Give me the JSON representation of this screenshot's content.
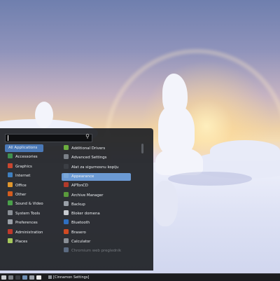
{
  "menu": {
    "search": {
      "value": "",
      "placeholder": ""
    },
    "categories": [
      {
        "label": "All Applications",
        "selected": true,
        "color": "#4a78b6"
      },
      {
        "label": "Accessories",
        "selected": false,
        "color": "#3f8f4f"
      },
      {
        "label": "Graphics",
        "selected": false,
        "color": "#c9462f"
      },
      {
        "label": "Internet",
        "selected": false,
        "color": "#3e7fbf"
      },
      {
        "label": "Office",
        "selected": false,
        "color": "#e0962c"
      },
      {
        "label": "Other",
        "selected": false,
        "color": "#d35c1e"
      },
      {
        "label": "Sound & Video",
        "selected": false,
        "color": "#4aa04a"
      },
      {
        "label": "System Tools",
        "selected": false,
        "color": "#8a8f96"
      },
      {
        "label": "Preferences",
        "selected": false,
        "color": "#9aa0a8"
      },
      {
        "label": "Administration",
        "selected": false,
        "color": "#c0392b"
      },
      {
        "label": "Places",
        "selected": false,
        "color": "#a5c85b"
      }
    ],
    "apps": [
      {
        "label": "Additional Drivers",
        "selected": false,
        "dim": false,
        "color": "#6cae3f"
      },
      {
        "label": "Advanced Settings",
        "selected": false,
        "dim": false,
        "color": "#7a7f86"
      },
      {
        "label": "Alat za sigurnosnu kopiju",
        "selected": false,
        "dim": false,
        "color": "#3b3e44"
      },
      {
        "label": "Appearance",
        "selected": true,
        "dim": false,
        "color": "#7aa7d9"
      },
      {
        "label": "APTonCD",
        "selected": false,
        "dim": false,
        "color": "#b23a2a"
      },
      {
        "label": "Archive Manager",
        "selected": false,
        "dim": false,
        "color": "#5a9a3c"
      },
      {
        "label": "Backup",
        "selected": false,
        "dim": false,
        "color": "#9aa0a8"
      },
      {
        "label": "Bloker domena",
        "selected": false,
        "dim": false,
        "color": "#c8cbd0"
      },
      {
        "label": "Bluetooth",
        "selected": false,
        "dim": false,
        "color": "#2f6fc0"
      },
      {
        "label": "Brasero",
        "selected": false,
        "dim": false,
        "color": "#d04a22"
      },
      {
        "label": "Calculator",
        "selected": false,
        "dim": false,
        "color": "#8a8f96"
      },
      {
        "label": "Chromium web preglednik",
        "selected": false,
        "dim": true,
        "color": "#5b6a80"
      }
    ]
  },
  "taskbar": {
    "launchers": [
      {
        "name": "menu-icon",
        "color": "#c8cbd0"
      },
      {
        "name": "files-icon",
        "color": "#7a7f86"
      },
      {
        "name": "terminal-icon",
        "color": "#3b3e44"
      },
      {
        "name": "browser-icon",
        "color": "#6e8fb5"
      },
      {
        "name": "editor-icon",
        "color": "#9aa0a8"
      },
      {
        "name": "shield-icon",
        "color": "#e8e8e8"
      }
    ],
    "window_label": "[Cinnamon Settings]"
  }
}
